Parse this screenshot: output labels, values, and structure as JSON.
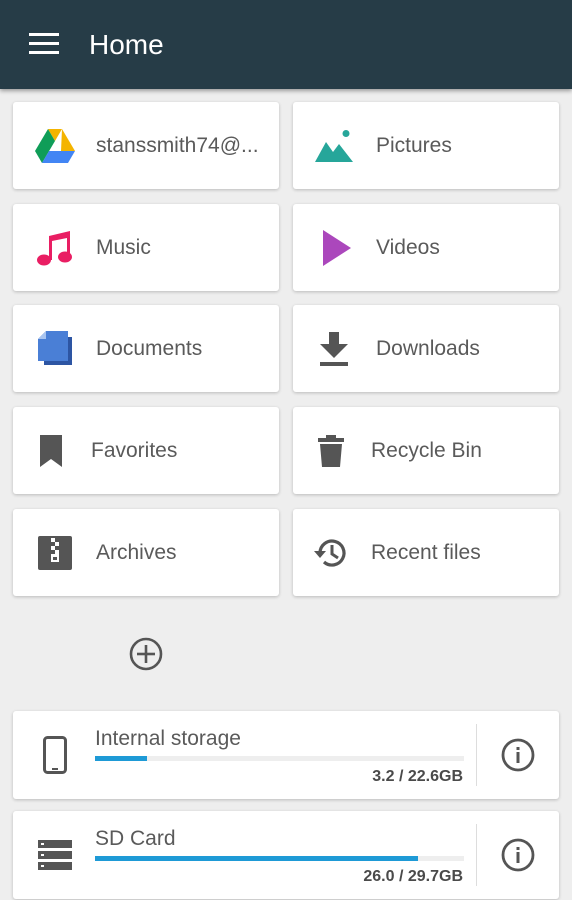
{
  "appbar": {
    "title": "Home",
    "menu_icon": "hamburger-menu-icon",
    "background": "#263c47"
  },
  "tiles": [
    {
      "label": "stanssmith74@...",
      "icon": "google-drive-icon"
    },
    {
      "label": "Pictures",
      "icon": "pictures-icon",
      "color": "#26a69a"
    },
    {
      "label": "Music",
      "icon": "music-note-icon",
      "color": "#e91e63"
    },
    {
      "label": "Videos",
      "icon": "play-icon",
      "color": "#ab47bc"
    },
    {
      "label": "Documents",
      "icon": "documents-icon",
      "color": "#3f6fc9"
    },
    {
      "label": "Downloads",
      "icon": "download-icon",
      "color": "#555555"
    },
    {
      "label": "Favorites",
      "icon": "bookmark-icon",
      "color": "#555555"
    },
    {
      "label": "Recycle Bin",
      "icon": "trash-icon",
      "color": "#555555"
    },
    {
      "label": "Archives",
      "icon": "archive-zip-icon",
      "color": "#555555"
    },
    {
      "label": "Recent files",
      "icon": "history-icon",
      "color": "#555555"
    }
  ],
  "add_button": {
    "icon": "add-circle-icon"
  },
  "storage": [
    {
      "name": "Internal storage",
      "usage": "3.2 / 22.6GB",
      "fraction": 0.14,
      "icon": "phone-icon"
    },
    {
      "name": "SD Card",
      "usage": "26.0 / 29.7GB",
      "fraction": 0.875,
      "icon": "sd-card-storage-icon"
    }
  ],
  "colors": {
    "accent": "#1e9ad6",
    "background": "#eeeeee"
  }
}
